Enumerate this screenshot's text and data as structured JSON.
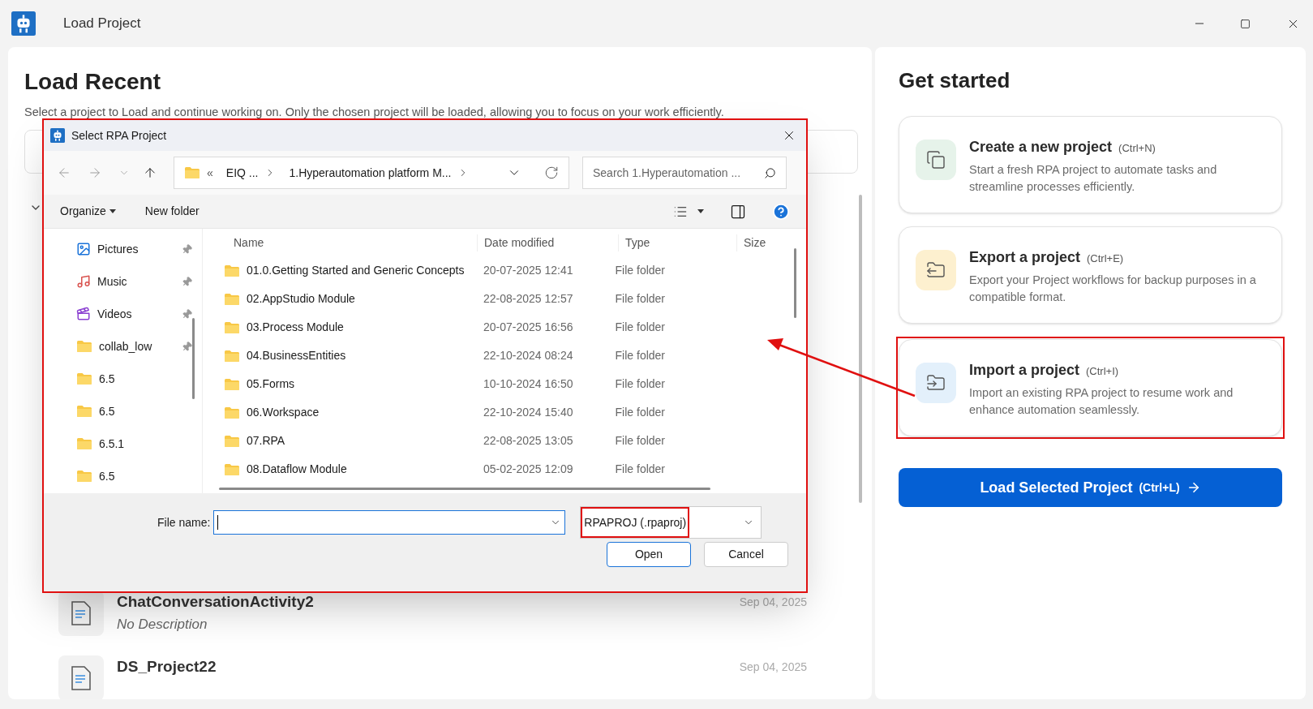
{
  "window": {
    "title": "Load Project"
  },
  "recent": {
    "title": "Load Recent",
    "subtitle": "Select a project to Load and continue working on. Only the chosen project will be loaded, allowing you to focus on your work efficiently.",
    "projects": [
      {
        "name": "ChatConversationActivity2",
        "description": "No Description",
        "date": "Sep 04, 2025"
      },
      {
        "name": "DS_Project22",
        "date": "Sep 04, 2025"
      }
    ]
  },
  "get_started": {
    "title": "Get started",
    "actions": [
      {
        "kind": "create",
        "title": "Create a new project",
        "shortcut": "(Ctrl+N)",
        "description": "Start a fresh RPA project to automate tasks and streamline processes efficiently.",
        "highlighted": false
      },
      {
        "kind": "export",
        "title": "Export a project",
        "shortcut": "(Ctrl+E)",
        "description": "Export your Project workflows for backup purposes in a compatible format.",
        "highlighted": false
      },
      {
        "kind": "import",
        "title": "Import a project",
        "shortcut": "(Ctrl+I)",
        "description": "Import an existing RPA project to resume work and enhance automation seamlessly.",
        "highlighted": true
      }
    ],
    "primary_button": {
      "label": "Load Selected Project",
      "shortcut": "(Ctrl+L)"
    }
  },
  "dialog": {
    "title": "Select RPA Project",
    "address": {
      "overflow": "«",
      "segments": [
        "EIQ ...",
        "1.Hyperautomation platform M..."
      ]
    },
    "search": {
      "placeholder": "Search 1.Hyperautomation ..."
    },
    "toolbar": {
      "organize": "Organize",
      "new_folder": "New folder"
    },
    "nav_items": [
      {
        "kind": "pictures",
        "label": "Pictures",
        "pinned": true
      },
      {
        "kind": "music",
        "label": "Music",
        "pinned": true
      },
      {
        "kind": "videos",
        "label": "Videos",
        "pinned": true
      },
      {
        "kind": "folder",
        "label": "collab_low",
        "pinned": true
      },
      {
        "kind": "folder",
        "label": "6.5",
        "pinned": false
      },
      {
        "kind": "folder",
        "label": "6.5",
        "pinned": false
      },
      {
        "kind": "folder",
        "label": "6.5.1",
        "pinned": false
      },
      {
        "kind": "folder",
        "label": "6.5",
        "pinned": false
      }
    ],
    "columns": [
      "Name",
      "Date modified",
      "Type",
      "Size"
    ],
    "rows": [
      {
        "name": "01.0.Getting Started and Generic Concepts",
        "date": "20-07-2025 12:41",
        "type": "File folder"
      },
      {
        "name": "02.AppStudio Module",
        "date": "22-08-2025 12:57",
        "type": "File folder"
      },
      {
        "name": "03.Process Module",
        "date": "20-07-2025 16:56",
        "type": "File folder"
      },
      {
        "name": "04.BusinessEntities",
        "date": "22-10-2024 08:24",
        "type": "File folder"
      },
      {
        "name": "05.Forms",
        "date": "10-10-2024 16:50",
        "type": "File folder"
      },
      {
        "name": "06.Workspace",
        "date": "22-10-2024 15:40",
        "type": "File folder"
      },
      {
        "name": "07.RPA",
        "date": "22-08-2025 13:05",
        "type": "File folder"
      },
      {
        "name": "08.Dataflow Module",
        "date": "05-02-2025 12:09",
        "type": "File folder"
      }
    ],
    "file_name_label": "File name:",
    "file_type": {
      "value": "RPAPROJ (.rpaproj)",
      "highlighted": true
    },
    "buttons": {
      "open": "Open",
      "cancel": "Cancel"
    }
  }
}
